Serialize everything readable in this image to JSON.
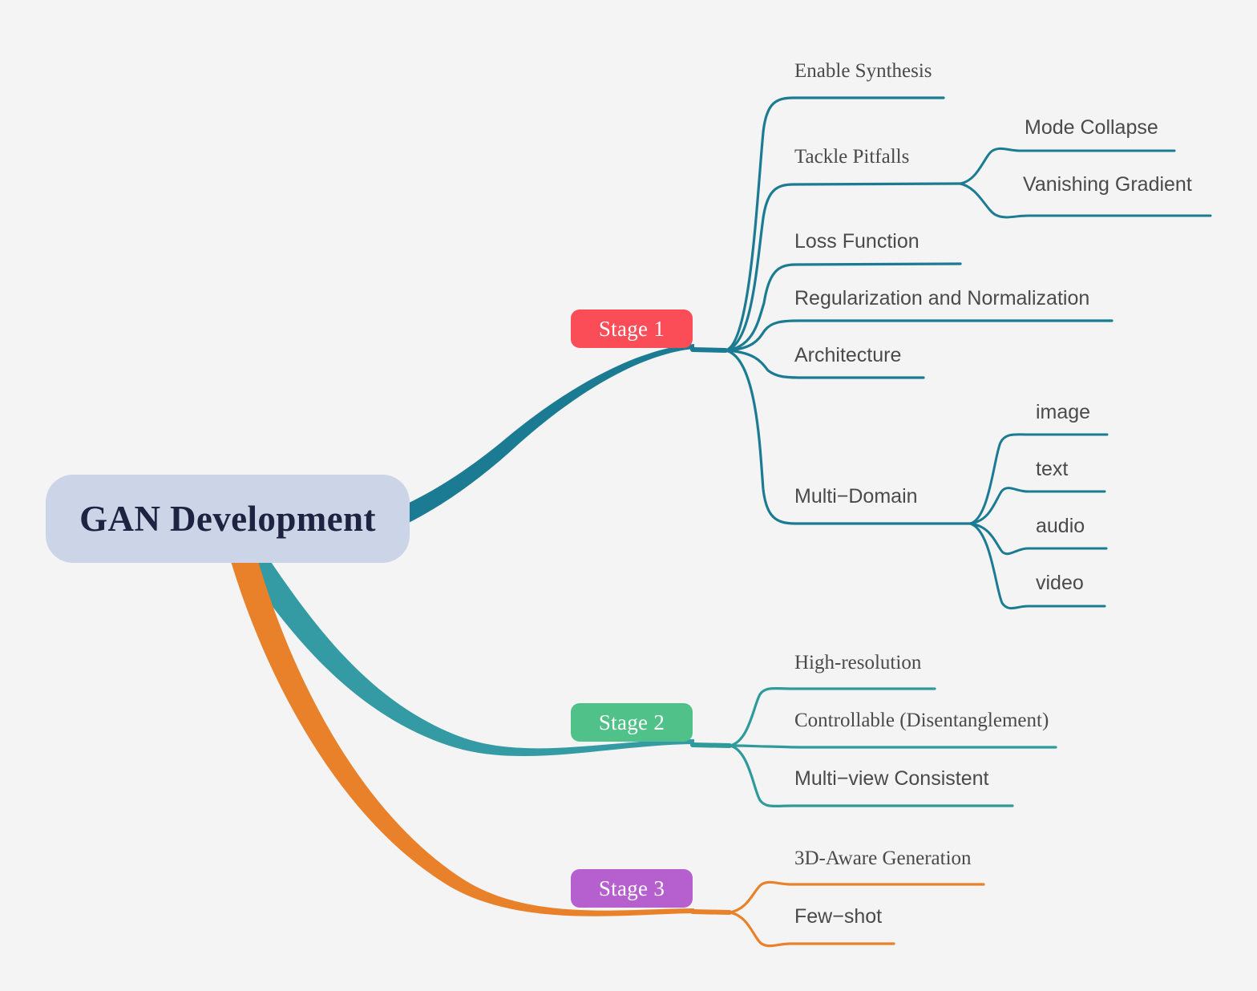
{
  "background_color": "#f4f4f4",
  "root": {
    "label": "GAN Development",
    "fill": "#ccd5e8",
    "text_color": "#1d2340"
  },
  "stages": [
    {
      "id": "stage-1",
      "label": "Stage 1",
      "color": "#fa4d57",
      "branch_color": "#1b7b93",
      "children": [
        {
          "label": "Enable Synthesis",
          "font": "serif"
        },
        {
          "label": "Tackle Pitfalls",
          "font": "serif",
          "children": [
            {
              "label": "Mode Collapse",
              "font": "sans"
            },
            {
              "label": "Vanishing Gradient",
              "font": "sans"
            }
          ]
        },
        {
          "label": "Loss Function",
          "font": "sans"
        },
        {
          "label": "Regularization and Normalization",
          "font": "sans"
        },
        {
          "label": "Architecture",
          "font": "sans"
        },
        {
          "label": "Multi−Domain",
          "font": "sans",
          "children": [
            {
              "label": "image",
              "font": "sans"
            },
            {
              "label": "text",
              "font": "sans"
            },
            {
              "label": "audio",
              "font": "sans"
            },
            {
              "label": "video",
              "font": "sans"
            }
          ]
        }
      ]
    },
    {
      "id": "stage-2",
      "label": "Stage 2",
      "color": "#4fc189",
      "branch_color": "#2e9a9a",
      "children": [
        {
          "label": "High-resolution",
          "font": "serif"
        },
        {
          "label": "Controllable (Disentanglement)",
          "font": "serif"
        },
        {
          "label": "Multi−view Consistent",
          "font": "sans"
        }
      ]
    },
    {
      "id": "stage-3",
      "label": "Stage 3",
      "color": "#b65fcf",
      "branch_color": "#e8812a",
      "children": [
        {
          "label": "3D-Aware Generation",
          "font": "serif"
        },
        {
          "label": "Few−shot",
          "font": "sans"
        }
      ]
    }
  ],
  "labels": {
    "enable_synthesis": "Enable Synthesis",
    "tackle_pitfalls": "Tackle Pitfalls",
    "mode_collapse": "Mode Collapse",
    "vanishing_gradient": "Vanishing Gradient",
    "loss_function": "Loss Function",
    "regularization": "Regularization and Normalization",
    "architecture": "Architecture",
    "multi_domain": "Multi−Domain",
    "image": "image",
    "text": "text",
    "audio": "audio",
    "video": "video",
    "high_resolution": "High-resolution",
    "controllable": "Controllable (Disentanglement)",
    "multi_view": "Multi−view Consistent",
    "three_d_aware": "3D-Aware Generation",
    "few_shot": "Few−shot"
  }
}
